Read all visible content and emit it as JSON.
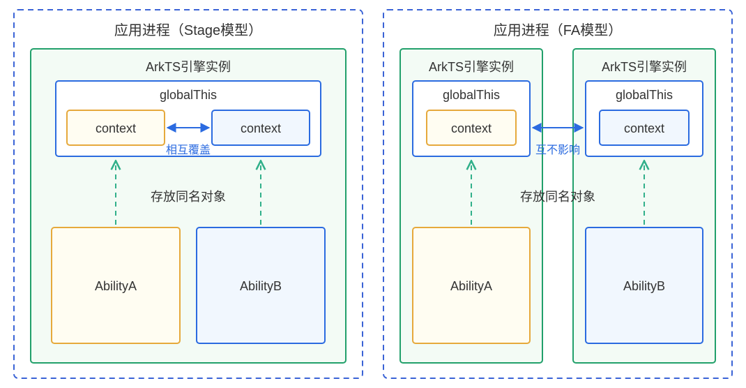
{
  "left": {
    "process_title": "应用进程（Stage模型）",
    "engine_title": "ArkTS引擎实例",
    "global_this": "globalThis",
    "context_a": "context",
    "context_b": "context",
    "relation": "相互覆盖",
    "store_label": "存放同名对象",
    "ability_a": "AbilityA",
    "ability_b": "AbilityB"
  },
  "right": {
    "process_title": "应用进程（FA模型）",
    "engine_a_title": "ArkTS引擎实例",
    "engine_b_title": "ArkTS引擎实例",
    "global_this_a": "globalThis",
    "global_this_b": "globalThis",
    "context_a": "context",
    "context_b": "context",
    "relation": "互不影响",
    "store_label": "存放同名对象",
    "ability_a": "AbilityA",
    "ability_b": "AbilityB"
  }
}
